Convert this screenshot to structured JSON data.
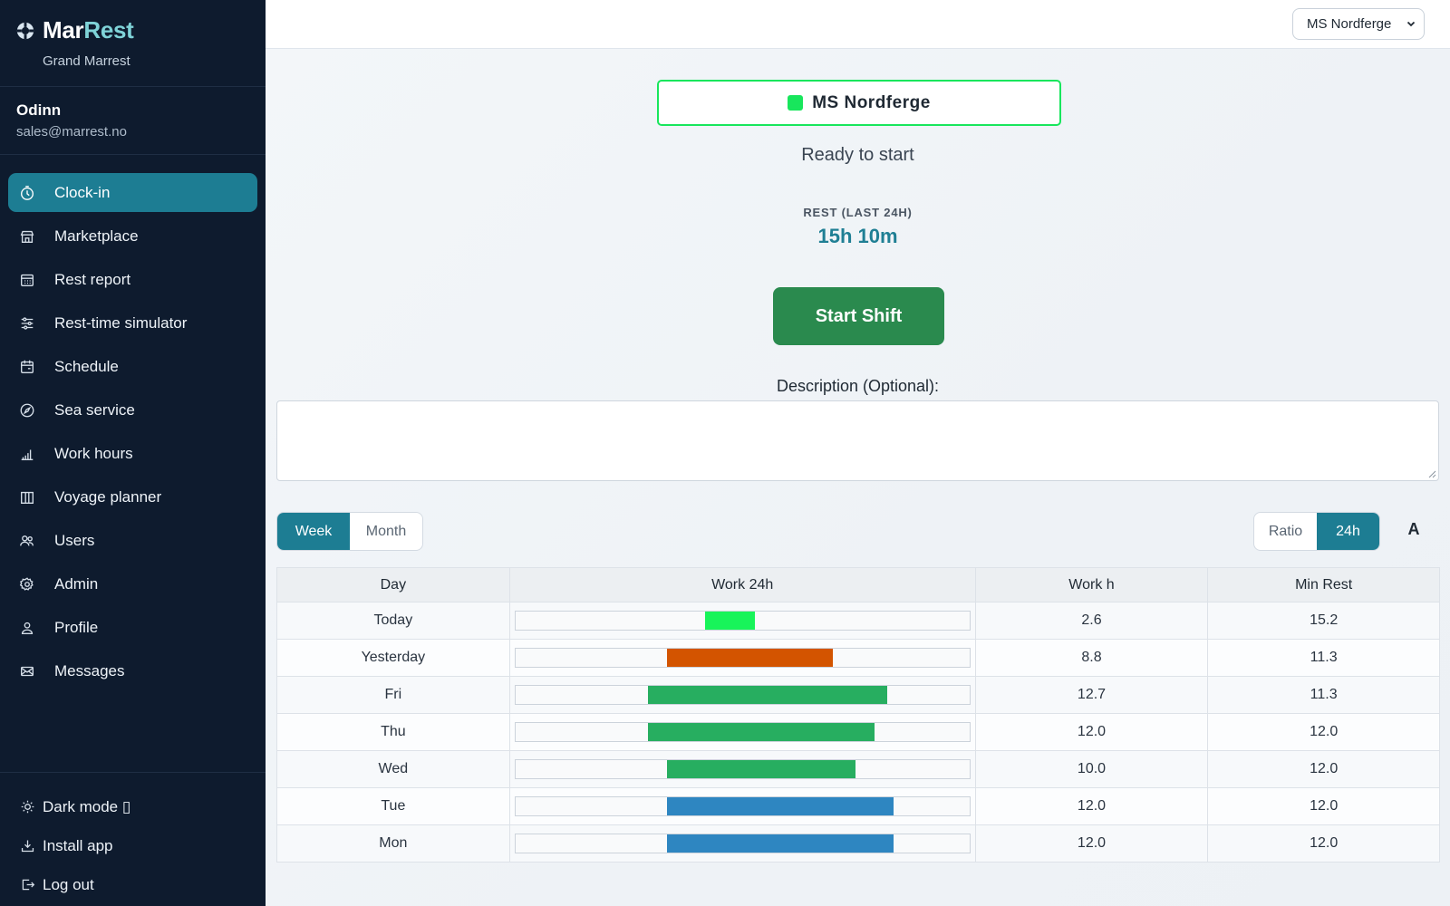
{
  "app": {
    "brand_part1": "Mar",
    "brand_part2": "Rest",
    "org": "Grand Marrest"
  },
  "user": {
    "name": "Odinn",
    "email": "sales@marrest.no"
  },
  "nav": [
    {
      "label": "Clock-in",
      "icon": "clock-icon",
      "active": true
    },
    {
      "label": "Marketplace",
      "icon": "store-icon"
    },
    {
      "label": "Rest report",
      "icon": "calendar-grid-icon"
    },
    {
      "label": "Rest-time simulator",
      "icon": "sliders-icon"
    },
    {
      "label": "Schedule",
      "icon": "calendar-icon"
    },
    {
      "label": "Sea service",
      "icon": "compass-icon"
    },
    {
      "label": "Work hours",
      "icon": "bar-chart-icon"
    },
    {
      "label": "Voyage planner",
      "icon": "map-icon"
    },
    {
      "label": "Users",
      "icon": "users-icon"
    },
    {
      "label": "Admin",
      "icon": "gear-icon"
    },
    {
      "label": "Profile",
      "icon": "user-icon"
    },
    {
      "label": "Messages",
      "icon": "mail-icon"
    }
  ],
  "sidebar_bottom": {
    "dark_mode": "Dark mode ▯",
    "install": "Install app",
    "logout": "Log out"
  },
  "topbar": {
    "vessel_selected": "MS Nordferge"
  },
  "clock": {
    "vessel": "MS Nordferge",
    "status": "Ready to start",
    "rest_label": "REST (LAST 24H)",
    "rest_value": "15h 10m",
    "start_button": "Start Shift",
    "description_label": "Description (Optional):",
    "description_value": ""
  },
  "period_toggle": {
    "week": "Week",
    "month": "Month",
    "selected": "Week"
  },
  "view_toggle": {
    "ratio": "Ratio",
    "h24": "24h",
    "selected": "24h"
  },
  "font_toggle": "A",
  "table": {
    "headers": [
      "Day",
      "Work 24h",
      "Work h",
      "Min Rest"
    ],
    "rows": [
      {
        "day": "Today",
        "work_h": "2.6",
        "min_rest": "15.2",
        "bar_start": 0.417,
        "bar_end": 0.527,
        "color": "#18f45a"
      },
      {
        "day": "Yesterday",
        "work_h": "8.8",
        "min_rest": "11.3",
        "bar_start": 0.333,
        "bar_end": 0.7,
        "color": "#d35400"
      },
      {
        "day": "Fri",
        "work_h": "12.7",
        "min_rest": "11.3",
        "bar_start": 0.292,
        "bar_end": 0.82,
        "color": "#27ae60"
      },
      {
        "day": "Thu",
        "work_h": "12.0",
        "min_rest": "12.0",
        "bar_start": 0.292,
        "bar_end": 0.792,
        "color": "#27ae60"
      },
      {
        "day": "Wed",
        "work_h": "10.0",
        "min_rest": "12.0",
        "bar_start": 0.333,
        "bar_end": 0.75,
        "color": "#27ae60"
      },
      {
        "day": "Tue",
        "work_h": "12.0",
        "min_rest": "12.0",
        "bar_start": 0.333,
        "bar_end": 0.833,
        "color": "#2e86c1"
      },
      {
        "day": "Mon",
        "work_h": "12.0",
        "min_rest": "12.0",
        "bar_start": 0.333,
        "bar_end": 0.833,
        "color": "#2e86c1"
      }
    ]
  }
}
